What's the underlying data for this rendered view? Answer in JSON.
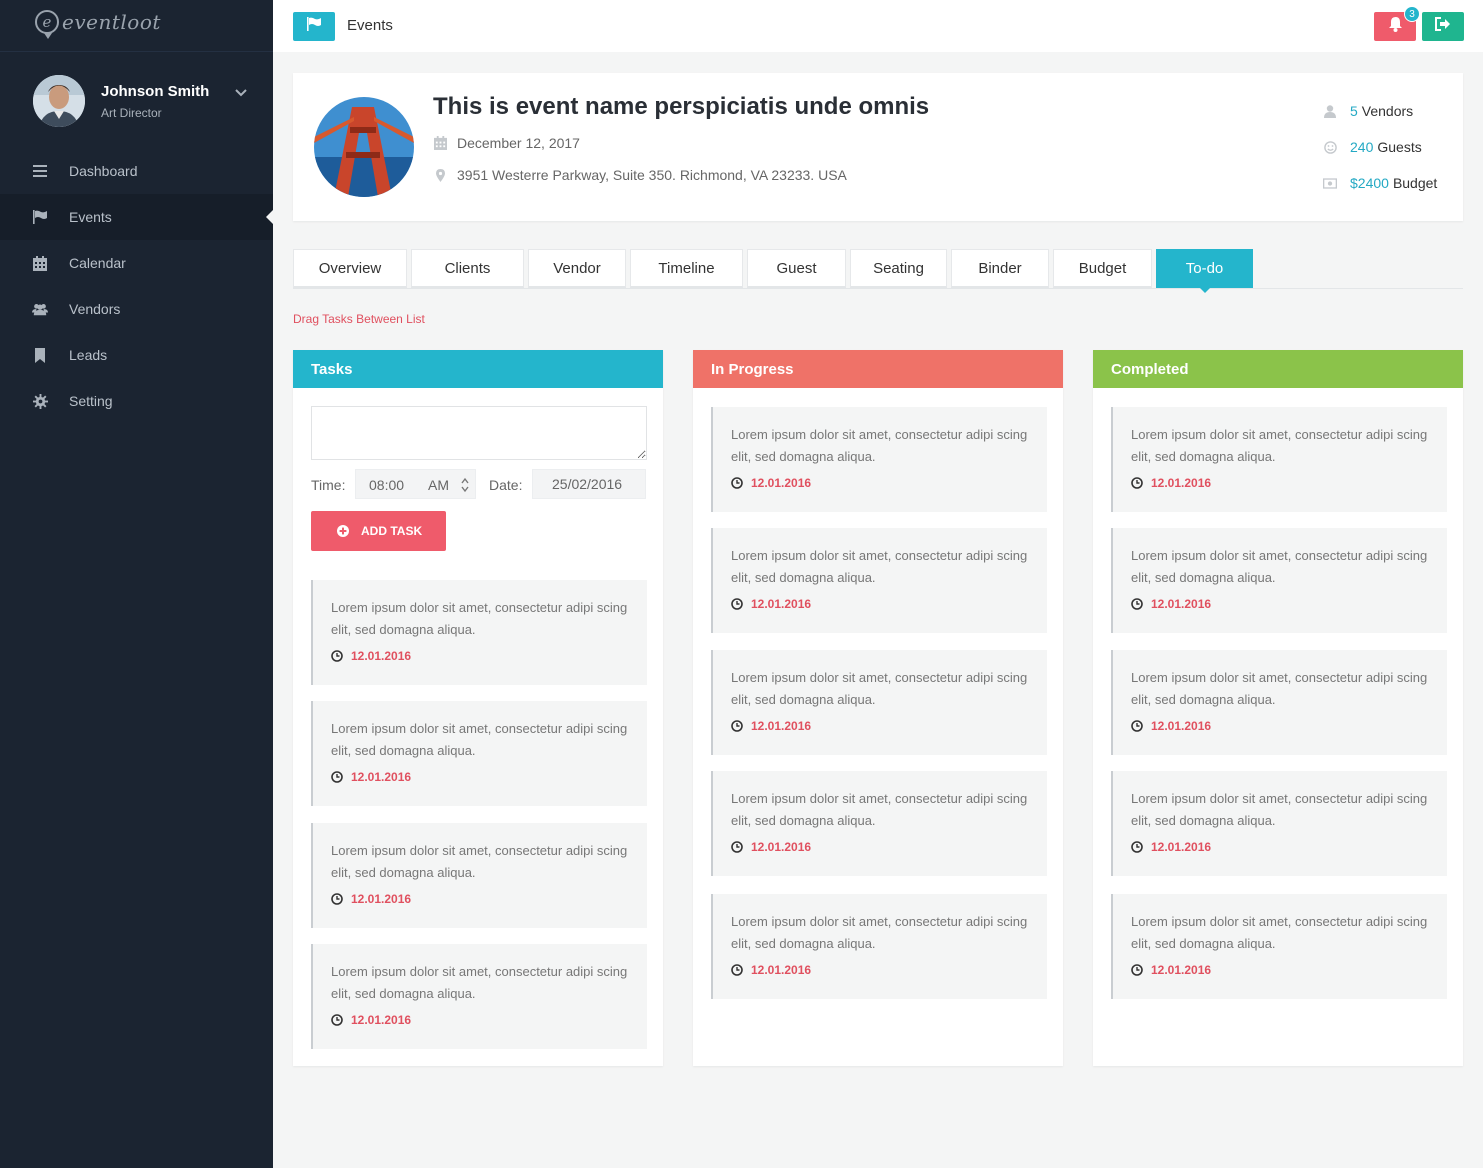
{
  "brand": {
    "logo_letter": "e",
    "name": "eventloot"
  },
  "user": {
    "name": "Johnson Smith",
    "role": "Art Director"
  },
  "nav": [
    {
      "label": "Dashboard",
      "icon": "menu-icon"
    },
    {
      "label": "Events",
      "icon": "flag-icon",
      "active": true
    },
    {
      "label": "Calendar",
      "icon": "calendar-icon"
    },
    {
      "label": "Vendors",
      "icon": "users-icon"
    },
    {
      "label": "Leads",
      "icon": "bookmark-icon"
    },
    {
      "label": "Setting",
      "icon": "gear-icon"
    }
  ],
  "topbar": {
    "title": "Events",
    "notification_count": "3"
  },
  "event": {
    "title": "This is event name  perspiciatis unde omnis",
    "date": "December 12, 2017",
    "address": "3951 Westerre Parkway, Suite 350. Richmond, VA 23233. USA",
    "stats": [
      {
        "value": "5",
        "label": "Vendors",
        "icon": "user-icon"
      },
      {
        "value": "240",
        "label": "Guests",
        "icon": "smile-icon"
      },
      {
        "value": "$2400",
        "label": "Budget",
        "icon": "money-icon"
      }
    ]
  },
  "tabs": [
    "Overview",
    "Clients",
    "Vendor",
    "Timeline",
    "Guest",
    "Seating",
    "Binder",
    "Budget",
    "To-do"
  ],
  "active_tab": "To-do",
  "hint": "Drag Tasks Between List",
  "form": {
    "time_label": "Time:",
    "time_value": "08:00",
    "time_period": "AM",
    "date_label": "Date:",
    "date_value": "25/02/2016",
    "add_button": "ADD TASK"
  },
  "columns": [
    {
      "title": "Tasks",
      "color": "#24b5cc",
      "cards": [
        {
          "text": "Lorem ipsum dolor sit amet, consectetur adipi scing elit, sed domagna aliqua.",
          "date": "12.01.2016"
        },
        {
          "text": "Lorem ipsum dolor sit amet, consectetur adipi scing elit, sed domagna aliqua.",
          "date": "12.01.2016"
        },
        {
          "text": "Lorem ipsum dolor sit amet, consectetur adipi scing elit, sed domagna aliqua.",
          "date": "12.01.2016"
        },
        {
          "text": "Lorem ipsum dolor sit amet, consectetur adipi scing elit, sed domagna aliqua.",
          "date": "12.01.2016"
        }
      ]
    },
    {
      "title": "In Progress",
      "color": "#ef7268",
      "cards": [
        {
          "text": "Lorem ipsum dolor sit amet, consectetur adipi scing elit, sed domagna aliqua.",
          "date": "12.01.2016"
        },
        {
          "text": "Lorem ipsum dolor sit amet, consectetur adipi scing elit, sed domagna aliqua.",
          "date": "12.01.2016"
        },
        {
          "text": "Lorem ipsum dolor sit amet, consectetur adipi scing elit, sed domagna aliqua.",
          "date": "12.01.2016"
        },
        {
          "text": "Lorem ipsum dolor sit amet, consectetur adipi scing elit, sed domagna aliqua.",
          "date": "12.01.2016"
        },
        {
          "text": "Lorem ipsum dolor sit amet, consectetur adipi scing elit, sed domagna aliqua.",
          "date": "12.01.2016"
        }
      ]
    },
    {
      "title": "Completed",
      "color": "#8bc34a",
      "cards": [
        {
          "text": "Lorem ipsum dolor sit amet, consectetur adipi scing elit, sed domagna aliqua.",
          "date": "12.01.2016"
        },
        {
          "text": "Lorem ipsum dolor sit amet, consectetur adipi scing elit, sed domagna aliqua.",
          "date": "12.01.2016"
        },
        {
          "text": "Lorem ipsum dolor sit amet, consectetur adipi scing elit, sed domagna aliqua.",
          "date": "12.01.2016"
        },
        {
          "text": "Lorem ipsum dolor sit amet, consectetur adipi scing elit, sed domagna aliqua.",
          "date": "12.01.2016"
        },
        {
          "text": "Lorem ipsum dolor sit amet, consectetur adipi scing elit, sed domagna aliqua.",
          "date": "12.01.2016"
        }
      ]
    }
  ]
}
